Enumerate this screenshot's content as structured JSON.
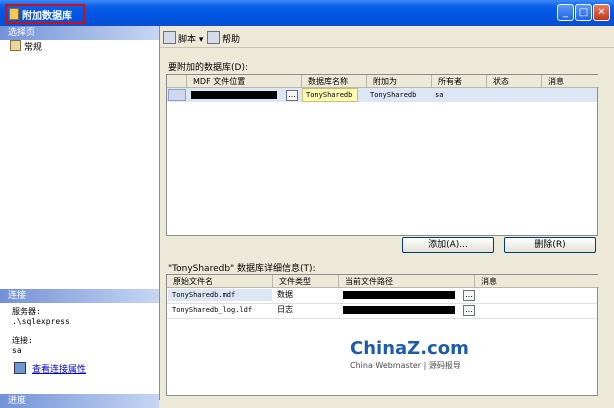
{
  "window": {
    "title": "附加数据库"
  },
  "left_pane": {
    "select_page_header": "选择页",
    "pages": [
      "常规"
    ],
    "connection_header": "连接",
    "server_label": "服务器:",
    "server_value": ".\\sqlexpress",
    "connection_label": "连接:",
    "connection_value": "sa",
    "view_link": "查看连接属性",
    "progress_header": "进度"
  },
  "toolbar": {
    "script_label": "脚本",
    "help_label": "帮助"
  },
  "databases": {
    "label": "要附加的数据库(D):",
    "columns": [
      "MDF 文件位置",
      "数据库名称",
      "附加为",
      "所有者",
      "状态",
      "消息"
    ],
    "rows": [
      {
        "mdf": "",
        "db_name": "TonySharedb",
        "attach_as": "TonySharedb",
        "owner": "sa",
        "status": "",
        "message": ""
      }
    ]
  },
  "buttons": {
    "add": "添加(A)...",
    "remove": "删除(R)"
  },
  "details": {
    "label": "\"TonySharedb\" 数据库详细信息(T):",
    "columns": [
      "原始文件名",
      "文件类型",
      "当前文件路径",
      "消息"
    ],
    "rows": [
      {
        "file": "TonySharedb.mdf",
        "type": "数据"
      },
      {
        "file": "TonySharedb_log.ldf",
        "type": "日志"
      }
    ]
  },
  "watermark": {
    "brand": "ChinaZ.com",
    "sub": "China Webmaster | 源码报导"
  }
}
